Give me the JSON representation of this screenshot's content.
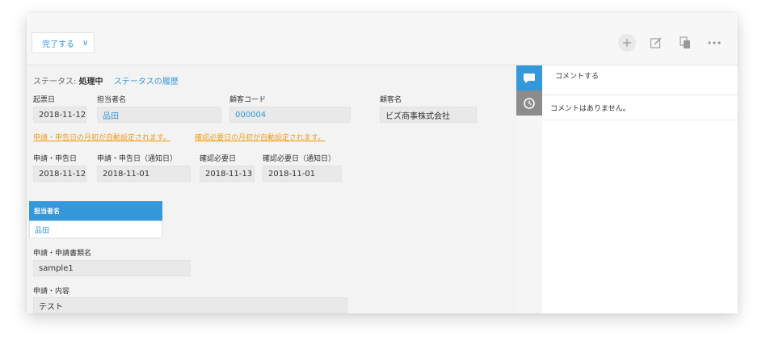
{
  "toolbar": {
    "status_action_label": "完了する",
    "icons": [
      "add-icon",
      "edit-icon",
      "copy-icon",
      "more-icon"
    ]
  },
  "status": {
    "label": "ステータス:",
    "value": "処理中",
    "history_link": "ステータスの履歴"
  },
  "fields": {
    "kihyobi": {
      "label": "起票日",
      "value": "2018-11-12"
    },
    "tantousha": {
      "label": "担当者名",
      "value": "品田"
    },
    "kokyaku_code": {
      "label": "顧客コード",
      "value": "000004"
    },
    "kokyaku_mei": {
      "label": "顧客名",
      "value": "ビズ商事株式会社"
    },
    "shinsei_bi": {
      "label": "申請・申告日",
      "value": "2018-11-12"
    },
    "shinsei_bi_tsuchi": {
      "label": "申請・申告日（通知日）",
      "value": "2018-11-01"
    },
    "kakunin_bi": {
      "label": "確認必要日",
      "value": "2018-11-13"
    },
    "kakunin_bi_tsuchi": {
      "label": "確認必要日（通知日）",
      "value": "2018-11-01"
    },
    "shorui_mei": {
      "label": "申請・申請書類名",
      "value": "sample1"
    },
    "naiyou": {
      "label": "申請・内容",
      "value": "テスト"
    }
  },
  "notices": {
    "shinsei_notice": "申請・申告日の月初が自動設定されます。",
    "kakunin_notice": "確認必要日の月初が自動設定されます。"
  },
  "table": {
    "header": "担当者名",
    "rows": [
      "品田"
    ]
  },
  "comments": {
    "compose_placeholder": "コメントする",
    "empty_text": "コメントはありません。"
  },
  "colors": {
    "accent": "#3498db",
    "notice": "#f39c12",
    "history_tab": "#8c8c8c"
  }
}
